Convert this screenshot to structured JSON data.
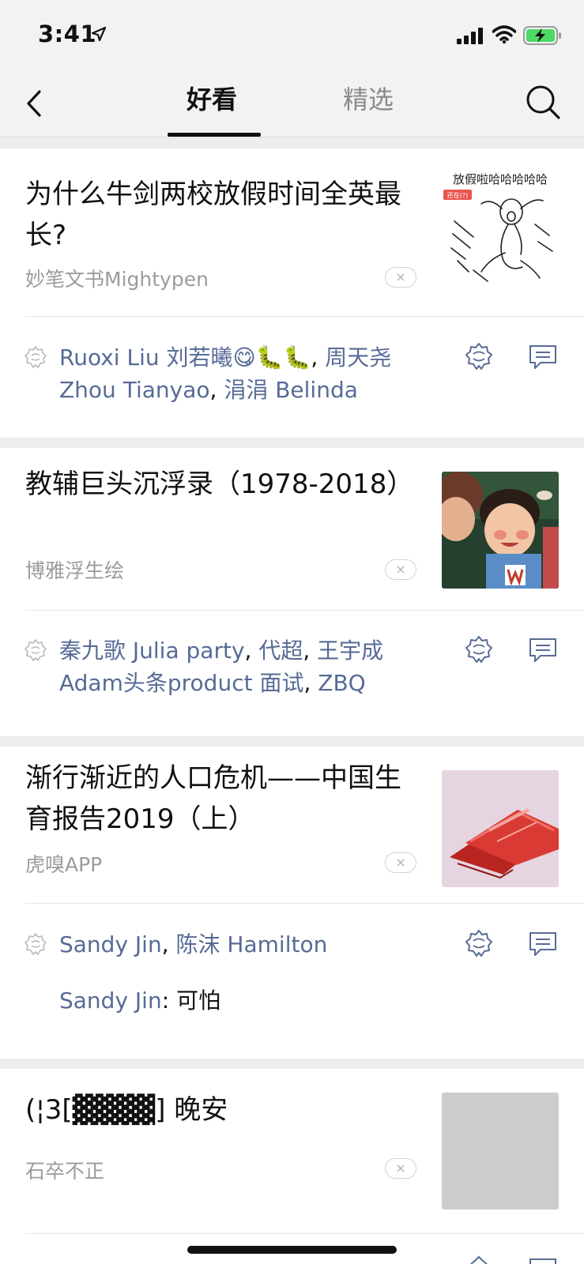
{
  "status_bar": {
    "time": "3:41"
  },
  "nav": {
    "tabs": [
      {
        "label": "好看"
      },
      {
        "label": "精选"
      }
    ]
  },
  "articles": [
    {
      "title": "为什么牛剑两校放假时间全英最长?",
      "source": "妙笔文书Mightypen",
      "thumb_caption": "放假啦哈哈哈哈哈",
      "thumb_badge": "还在(?)",
      "liked": [
        {
          "name": "Ruoxi Liu 刘若曦😋🐛🐛"
        },
        {
          "name": "周天尧 Zhou Tianyao"
        },
        {
          "name": "涓涓 Belinda"
        }
      ]
    },
    {
      "title": "教辅巨头沉浮录（1978-2018）",
      "source": "博雅浮生绘",
      "liked": [
        {
          "name": "秦九歌 Julia party"
        },
        {
          "name": "代超"
        },
        {
          "name": "王宇成Adam头条product 面试"
        },
        {
          "name": "ZBQ"
        }
      ]
    },
    {
      "title": "渐行渐近的人口危机——中国生育报告2019（上）",
      "source": "虎嗅APP",
      "liked": [
        {
          "name": "Sandy Jin"
        },
        {
          "name": "陈沫 Hamilton"
        }
      ],
      "comment": {
        "author": "Sandy Jin",
        "text": "可怕"
      }
    },
    {
      "title": "(¦3[▓▓▓▓] 晚安",
      "source": "石卒不正"
    }
  ],
  "ui": {
    "dismiss": "×",
    "separator": ", ",
    "comment_sep": ": "
  }
}
